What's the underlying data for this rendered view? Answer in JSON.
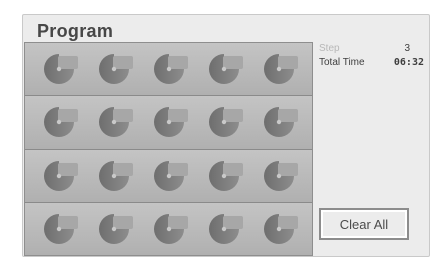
{
  "header": {
    "title": "Program"
  },
  "grid": {
    "rows": [
      {
        "slots": [
          "empty-slot-icon",
          "empty-slot-icon",
          "empty-slot-icon",
          "empty-slot-icon",
          "empty-slot-icon"
        ]
      },
      {
        "slots": [
          "empty-slot-icon",
          "empty-slot-icon",
          "empty-slot-icon",
          "empty-slot-icon",
          "empty-slot-icon"
        ]
      },
      {
        "slots": [
          "empty-slot-icon",
          "empty-slot-icon",
          "empty-slot-icon",
          "empty-slot-icon",
          "empty-slot-icon"
        ]
      },
      {
        "slots": [
          "empty-slot-icon",
          "empty-slot-icon",
          "empty-slot-icon",
          "empty-slot-icon",
          "empty-slot-icon"
        ]
      }
    ]
  },
  "info": {
    "step_label": "Step",
    "step_value": "3",
    "total_time_label": "Total Time",
    "total_time_value": "06:32"
  },
  "actions": {
    "clear_all_label": "Clear All"
  },
  "colors": {
    "panel_bg": "#ececec",
    "grid_bg": "#b5b5b5",
    "disc": "#6e6e6e",
    "text": "#474747"
  }
}
